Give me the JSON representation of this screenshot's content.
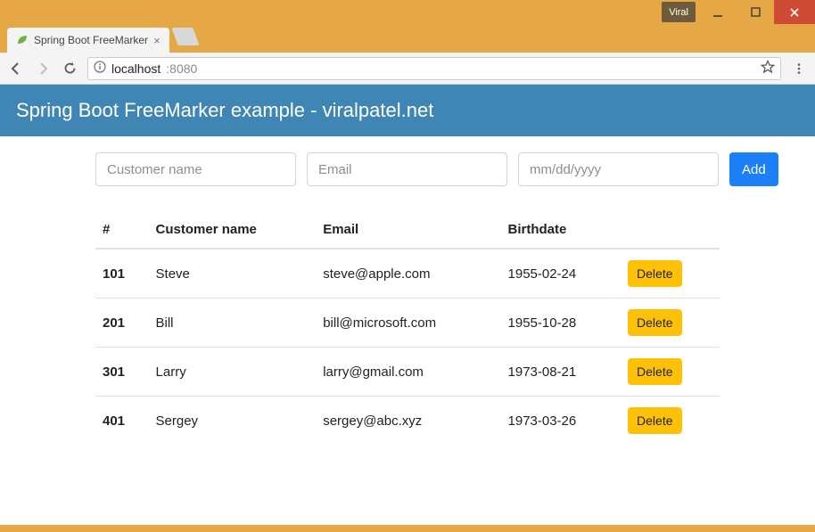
{
  "window": {
    "tag": "Viral",
    "tab_title": "Spring Boot FreeMarker",
    "url_host": "localhost",
    "url_port": ":8080"
  },
  "banner": {
    "title": "Spring Boot FreeMarker example - viralpatel.net"
  },
  "form": {
    "name_placeholder": "Customer name",
    "email_placeholder": "Email",
    "date_placeholder": "mm/dd/yyyy",
    "add_label": "Add"
  },
  "table": {
    "headers": {
      "id": "#",
      "name": "Customer name",
      "email": "Email",
      "birthdate": "Birthdate"
    },
    "delete_label": "Delete",
    "rows": [
      {
        "id": "101",
        "name": "Steve",
        "email": "steve@apple.com",
        "birthdate": "1955-02-24"
      },
      {
        "id": "201",
        "name": "Bill",
        "email": "bill@microsoft.com",
        "birthdate": "1955-10-28"
      },
      {
        "id": "301",
        "name": "Larry",
        "email": "larry@gmail.com",
        "birthdate": "1973-08-21"
      },
      {
        "id": "401",
        "name": "Sergey",
        "email": "sergey@abc.xyz",
        "birthdate": "1973-03-26"
      }
    ]
  }
}
